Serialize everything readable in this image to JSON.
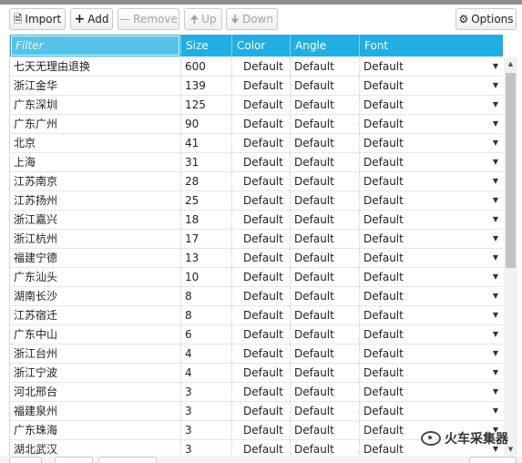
{
  "toolbar": {
    "import_label": "Import",
    "add_label": "Add",
    "remove_label": "Remove",
    "up_label": "Up",
    "down_label": "Down",
    "options_label": "Options"
  },
  "grid": {
    "filter_placeholder": "Filter",
    "columns": [
      "Size",
      "Color",
      "Angle",
      "Font"
    ],
    "rows": [
      {
        "name": "七天无理由退换",
        "size": "600",
        "color": "Default",
        "angle": "Default",
        "font": "Default"
      },
      {
        "name": "浙江金华",
        "size": "139",
        "color": "Default",
        "angle": "Default",
        "font": "Default"
      },
      {
        "name": "广东深圳",
        "size": "125",
        "color": "Default",
        "angle": "Default",
        "font": "Default"
      },
      {
        "name": "广东广州",
        "size": "90",
        "color": "Default",
        "angle": "Default",
        "font": "Default"
      },
      {
        "name": "北京",
        "size": "41",
        "color": "Default",
        "angle": "Default",
        "font": "Default"
      },
      {
        "name": "上海",
        "size": "31",
        "color": "Default",
        "angle": "Default",
        "font": "Default"
      },
      {
        "name": "江苏南京",
        "size": "28",
        "color": "Default",
        "angle": "Default",
        "font": "Default"
      },
      {
        "name": "江苏扬州",
        "size": "25",
        "color": "Default",
        "angle": "Default",
        "font": "Default"
      },
      {
        "name": "浙江嘉兴",
        "size": "18",
        "color": "Default",
        "angle": "Default",
        "font": "Default"
      },
      {
        "name": "浙江杭州",
        "size": "17",
        "color": "Default",
        "angle": "Default",
        "font": "Default"
      },
      {
        "name": "福建宁德",
        "size": "13",
        "color": "Default",
        "angle": "Default",
        "font": "Default"
      },
      {
        "name": "广东汕头",
        "size": "10",
        "color": "Default",
        "angle": "Default",
        "font": "Default"
      },
      {
        "name": "湖南长沙",
        "size": "8",
        "color": "Default",
        "angle": "Default",
        "font": "Default"
      },
      {
        "name": "江苏宿迁",
        "size": "8",
        "color": "Default",
        "angle": "Default",
        "font": "Default"
      },
      {
        "name": "广东中山",
        "size": "6",
        "color": "Default",
        "angle": "Default",
        "font": "Default"
      },
      {
        "name": "浙江台州",
        "size": "4",
        "color": "Default",
        "angle": "Default",
        "font": "Default"
      },
      {
        "name": "浙江宁波",
        "size": "4",
        "color": "Default",
        "angle": "Default",
        "font": "Default"
      },
      {
        "name": "河北邢台",
        "size": "3",
        "color": "Default",
        "angle": "Default",
        "font": "Default"
      },
      {
        "name": "福建泉州",
        "size": "3",
        "color": "Default",
        "angle": "Default",
        "font": "Default"
      },
      {
        "name": "广东珠海",
        "size": "3",
        "color": "Default",
        "angle": "Default",
        "font": "Default"
      },
      {
        "name": "湖北武汉",
        "size": "3",
        "color": "Default",
        "angle": "Default",
        "font": "Default"
      }
    ]
  },
  "watermark": {
    "text": "火车采集器"
  },
  "colors": {
    "header_bg": "#21aee3",
    "filter_bg": "#55c2ea"
  },
  "icons": {
    "import": "import-icon",
    "add": "plus-icon",
    "remove": "minus-icon",
    "up": "arrow-up-icon",
    "down": "arrow-down-icon",
    "options": "gear-icon",
    "font_dropdown": "caret-down-icon"
  }
}
